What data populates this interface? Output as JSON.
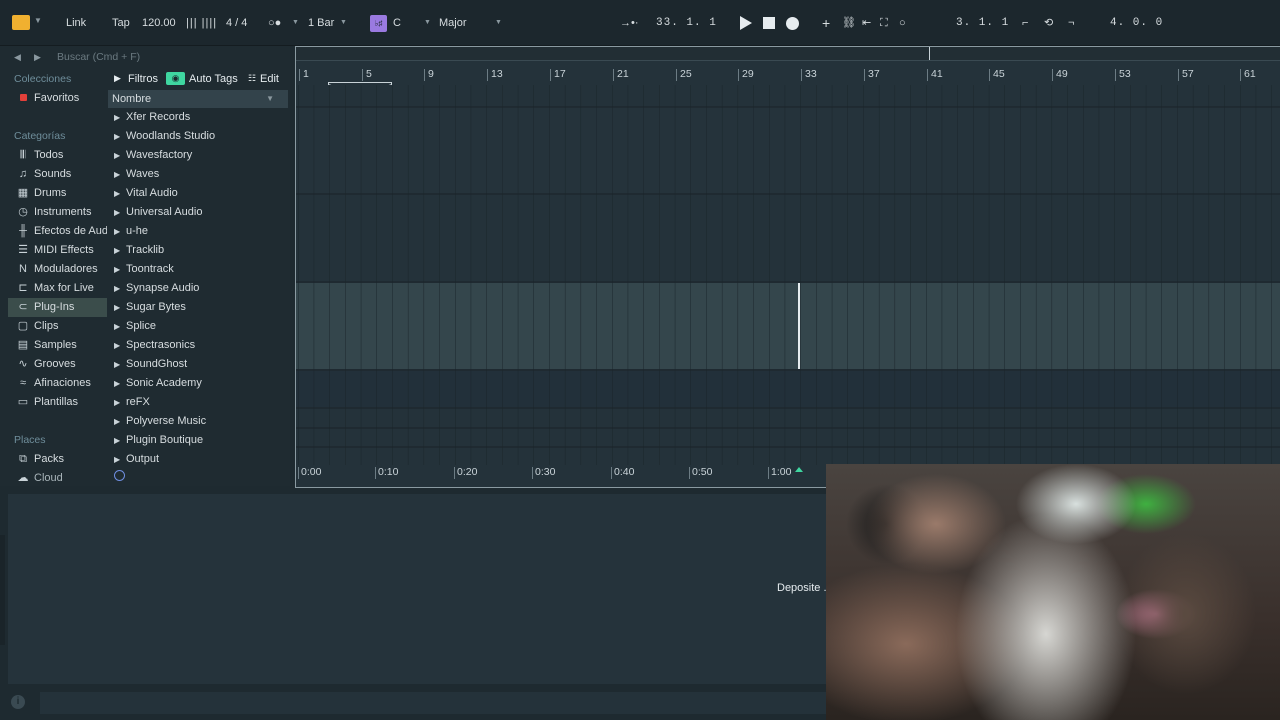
{
  "toolbar": {
    "link": "Link",
    "tap": "Tap",
    "tempo": "120.00",
    "time_signature": "4 / 4",
    "quantize": "1 Bar",
    "key_root": "C",
    "key_scale": "Major",
    "arrangement_position": "33.  1.  1",
    "loop_start": "3.  1.  1",
    "loop_length": "4.  0.  0"
  },
  "browser": {
    "search_placeholder": "Buscar (Cmd + F)",
    "collections_heading": "Colecciones",
    "favorites": "Favoritos",
    "categories_heading": "Categorías",
    "categories": [
      {
        "label": "Todos",
        "icon": "bars-icon"
      },
      {
        "label": "Sounds",
        "icon": "note-icon"
      },
      {
        "label": "Drums",
        "icon": "grid-icon"
      },
      {
        "label": "Instruments",
        "icon": "clock-icon"
      },
      {
        "label": "Efectos de Audio",
        "icon": "waveform-icon"
      },
      {
        "label": "MIDI Effects",
        "icon": "sliders-icon"
      },
      {
        "label": "Moduladores",
        "icon": "modulator-icon"
      },
      {
        "label": "Max for Live",
        "icon": "max-icon"
      },
      {
        "label": "Plug-Ins",
        "icon": "plug-icon"
      },
      {
        "label": "Clips",
        "icon": "clip-icon"
      },
      {
        "label": "Samples",
        "icon": "sample-icon"
      },
      {
        "label": "Grooves",
        "icon": "groove-icon"
      },
      {
        "label": "Afinaciones",
        "icon": "tuning-icon"
      },
      {
        "label": "Plantillas",
        "icon": "template-icon"
      }
    ],
    "places_heading": "Places",
    "places": [
      {
        "label": "Packs",
        "icon": "packs-icon"
      },
      {
        "label": "Cloud",
        "icon": "cloud-icon"
      }
    ],
    "filters_label": "Filtros",
    "auto_tags_label": "Auto Tags",
    "edit_label": "Edit",
    "name_column": "Nombre",
    "items": [
      "Xfer Records",
      "Woodlands Studio",
      "Wavesfactory",
      "Waves",
      "Vital Audio",
      "Universal Audio",
      "u-he",
      "Tracklib",
      "Toontrack",
      "Synapse Audio",
      "Sugar Bytes",
      "Splice",
      "Spectrasonics",
      "SoundGhost",
      "Sonic Academy",
      "reFX",
      "Polyverse Music",
      "Plugin Boutique",
      "Output"
    ]
  },
  "arrangement": {
    "bar_numbers": [
      "1",
      "5",
      "9",
      "13",
      "17",
      "21",
      "25",
      "29",
      "33",
      "37",
      "41",
      "45",
      "49",
      "53",
      "57",
      "61"
    ],
    "time_labels": [
      "0:00",
      "0:10",
      "0:20",
      "0:30",
      "0:40",
      "0:50",
      "1:00"
    ]
  },
  "detail": {
    "drop_hint": "Deposite ..."
  },
  "colors": {
    "accent_green": "#3fd6a0",
    "key_purple": "#9a7ae0",
    "selected_bg": "#3b4d4b",
    "favorite_red": "#e2403a"
  }
}
